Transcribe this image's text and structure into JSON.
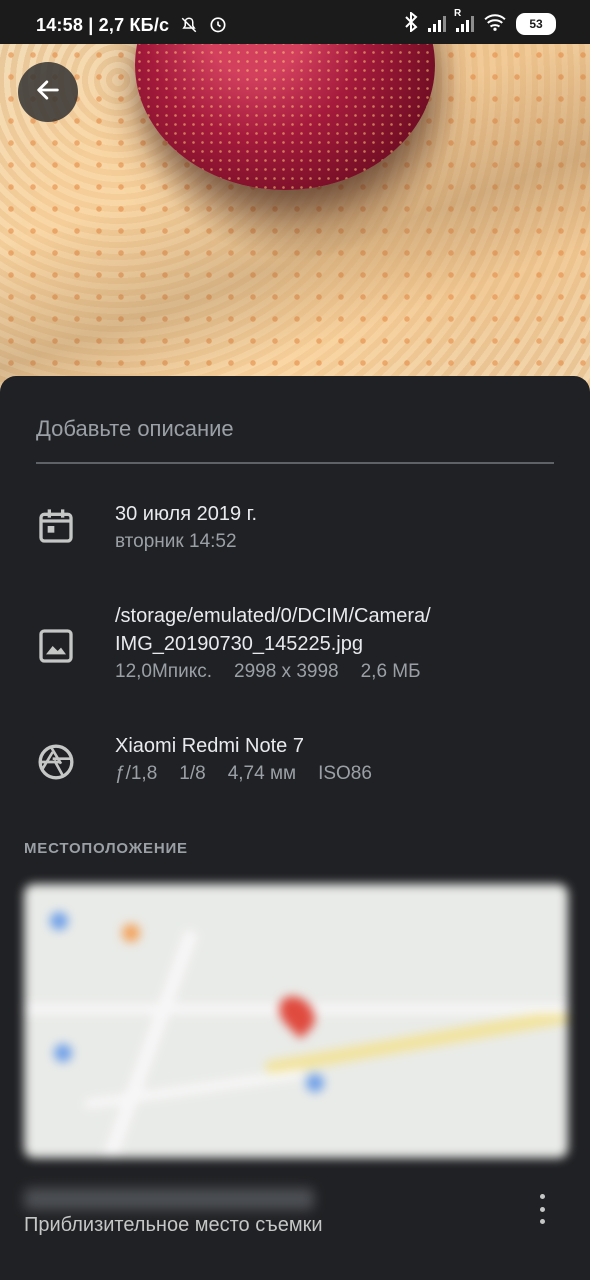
{
  "status_bar": {
    "time_speed": "14:58 | 2,7 КБ/с",
    "signal_sim2_label": "R",
    "battery": "53"
  },
  "photo": {
    "description_placeholder": "Добавьте описание"
  },
  "date_info": {
    "date": "30 июля 2019 г.",
    "weekday_time": "вторник 14:52"
  },
  "file_info": {
    "path_line1": "/storage/emulated/0/DCIM/Camera/",
    "path_line2": "IMG_20190730_145225.jpg",
    "megapixels": "12,0Мпикс.",
    "resolution": "2998 x 3998",
    "size": "2,6 МБ"
  },
  "camera_info": {
    "model": "Xiaomi Redmi Note 7",
    "aperture": "ƒ/1,8",
    "shutter": "1/8",
    "focal": "4,74 мм",
    "iso": "ISO86"
  },
  "location": {
    "section_title": "МЕСТОПОЛОЖЕНИЕ",
    "caption": "Приблизительное место съемки"
  },
  "icons": {
    "back": "arrow-left-icon",
    "date": "calendar-icon",
    "file": "image-icon",
    "camera": "aperture-icon",
    "more": "more-vert-icon"
  }
}
